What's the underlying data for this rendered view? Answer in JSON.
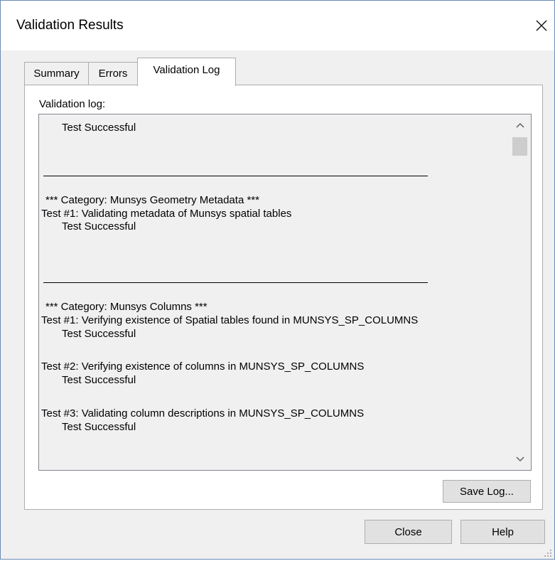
{
  "window": {
    "title": "Validation Results"
  },
  "tabs": [
    {
      "label": "Summary",
      "selected": false
    },
    {
      "label": "Errors",
      "selected": false
    },
    {
      "label": "Validation Log",
      "selected": true
    }
  ],
  "panel": {
    "label": "Validation log:"
  },
  "log": {
    "lines": [
      "Test Successful",
      "*** Category: Munsys Geometry Metadata ***",
      "Test #1: Validating metadata of Munsys spatial tables",
      "Test Successful",
      "*** Category: Munsys Columns ***",
      "Test #1: Verifying existence of Spatial tables found in MUNSYS_SP_COLUMNS",
      "Test Successful",
      "Test #2: Verifying existence of columns in MUNSYS_SP_COLUMNS",
      "Test Successful",
      "Test #3: Validating column descriptions in MUNSYS_SP_COLUMNS",
      "Test Successful"
    ]
  },
  "buttons": {
    "save_log": "Save Log...",
    "close": "Close",
    "help": "Help"
  },
  "icons": {
    "close": "close-icon",
    "scroll_up": "chevron-up-icon",
    "scroll_down": "chevron-down-icon",
    "resize": "resize-grip-icon"
  },
  "colors": {
    "window_border": "#6a8bb8",
    "dialog_bg": "#f0f0f0",
    "button_bg": "#e1e1e1"
  }
}
